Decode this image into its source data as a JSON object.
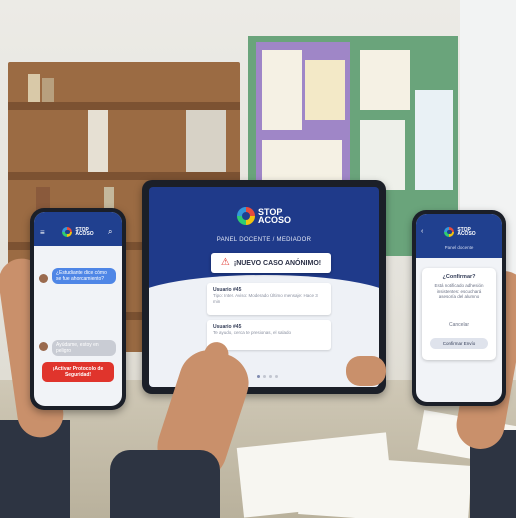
{
  "brand": {
    "line1": "STOP",
    "line2": "ACOSO"
  },
  "left_phone": {
    "bubble_in_1": "¿Estudiante dice cómo se fue ahorcamiento?",
    "bubble_in_2": "Ayúdame, estoy en peligro",
    "alert_button": "¡Activar Protocolo de Seguridad!"
  },
  "tablet": {
    "header_title": "PANEL DOCENTE / MEDIADOR",
    "alert_title": "¡NUEVO CASO ANÓNIMO!",
    "cards": [
      {
        "name": "Usuario #45",
        "text": "Tipo: Inter. Aviso: Moderado Último mensaje: Hace 3 min"
      },
      {
        "name": "Usuario #45",
        "text": "Te ayudo, cerca te presionas, el salado"
      }
    ],
    "alert_icon": "warning-triangle-icon"
  },
  "right_phone": {
    "title": "Panel docente",
    "dialog_title": "¿Confirmar?",
    "dialog_text": "Está notificado adhesión insistentes: escuchará asesoría del alumno",
    "cancel_label": "Cancelar",
    "confirm_label": "Confirmar Envío"
  },
  "colors": {
    "brand_blue": "#20408f",
    "alert_red": "#e0342c",
    "bubble_blue": "#4f86e6",
    "screen_bg": "#f1f3f7"
  }
}
